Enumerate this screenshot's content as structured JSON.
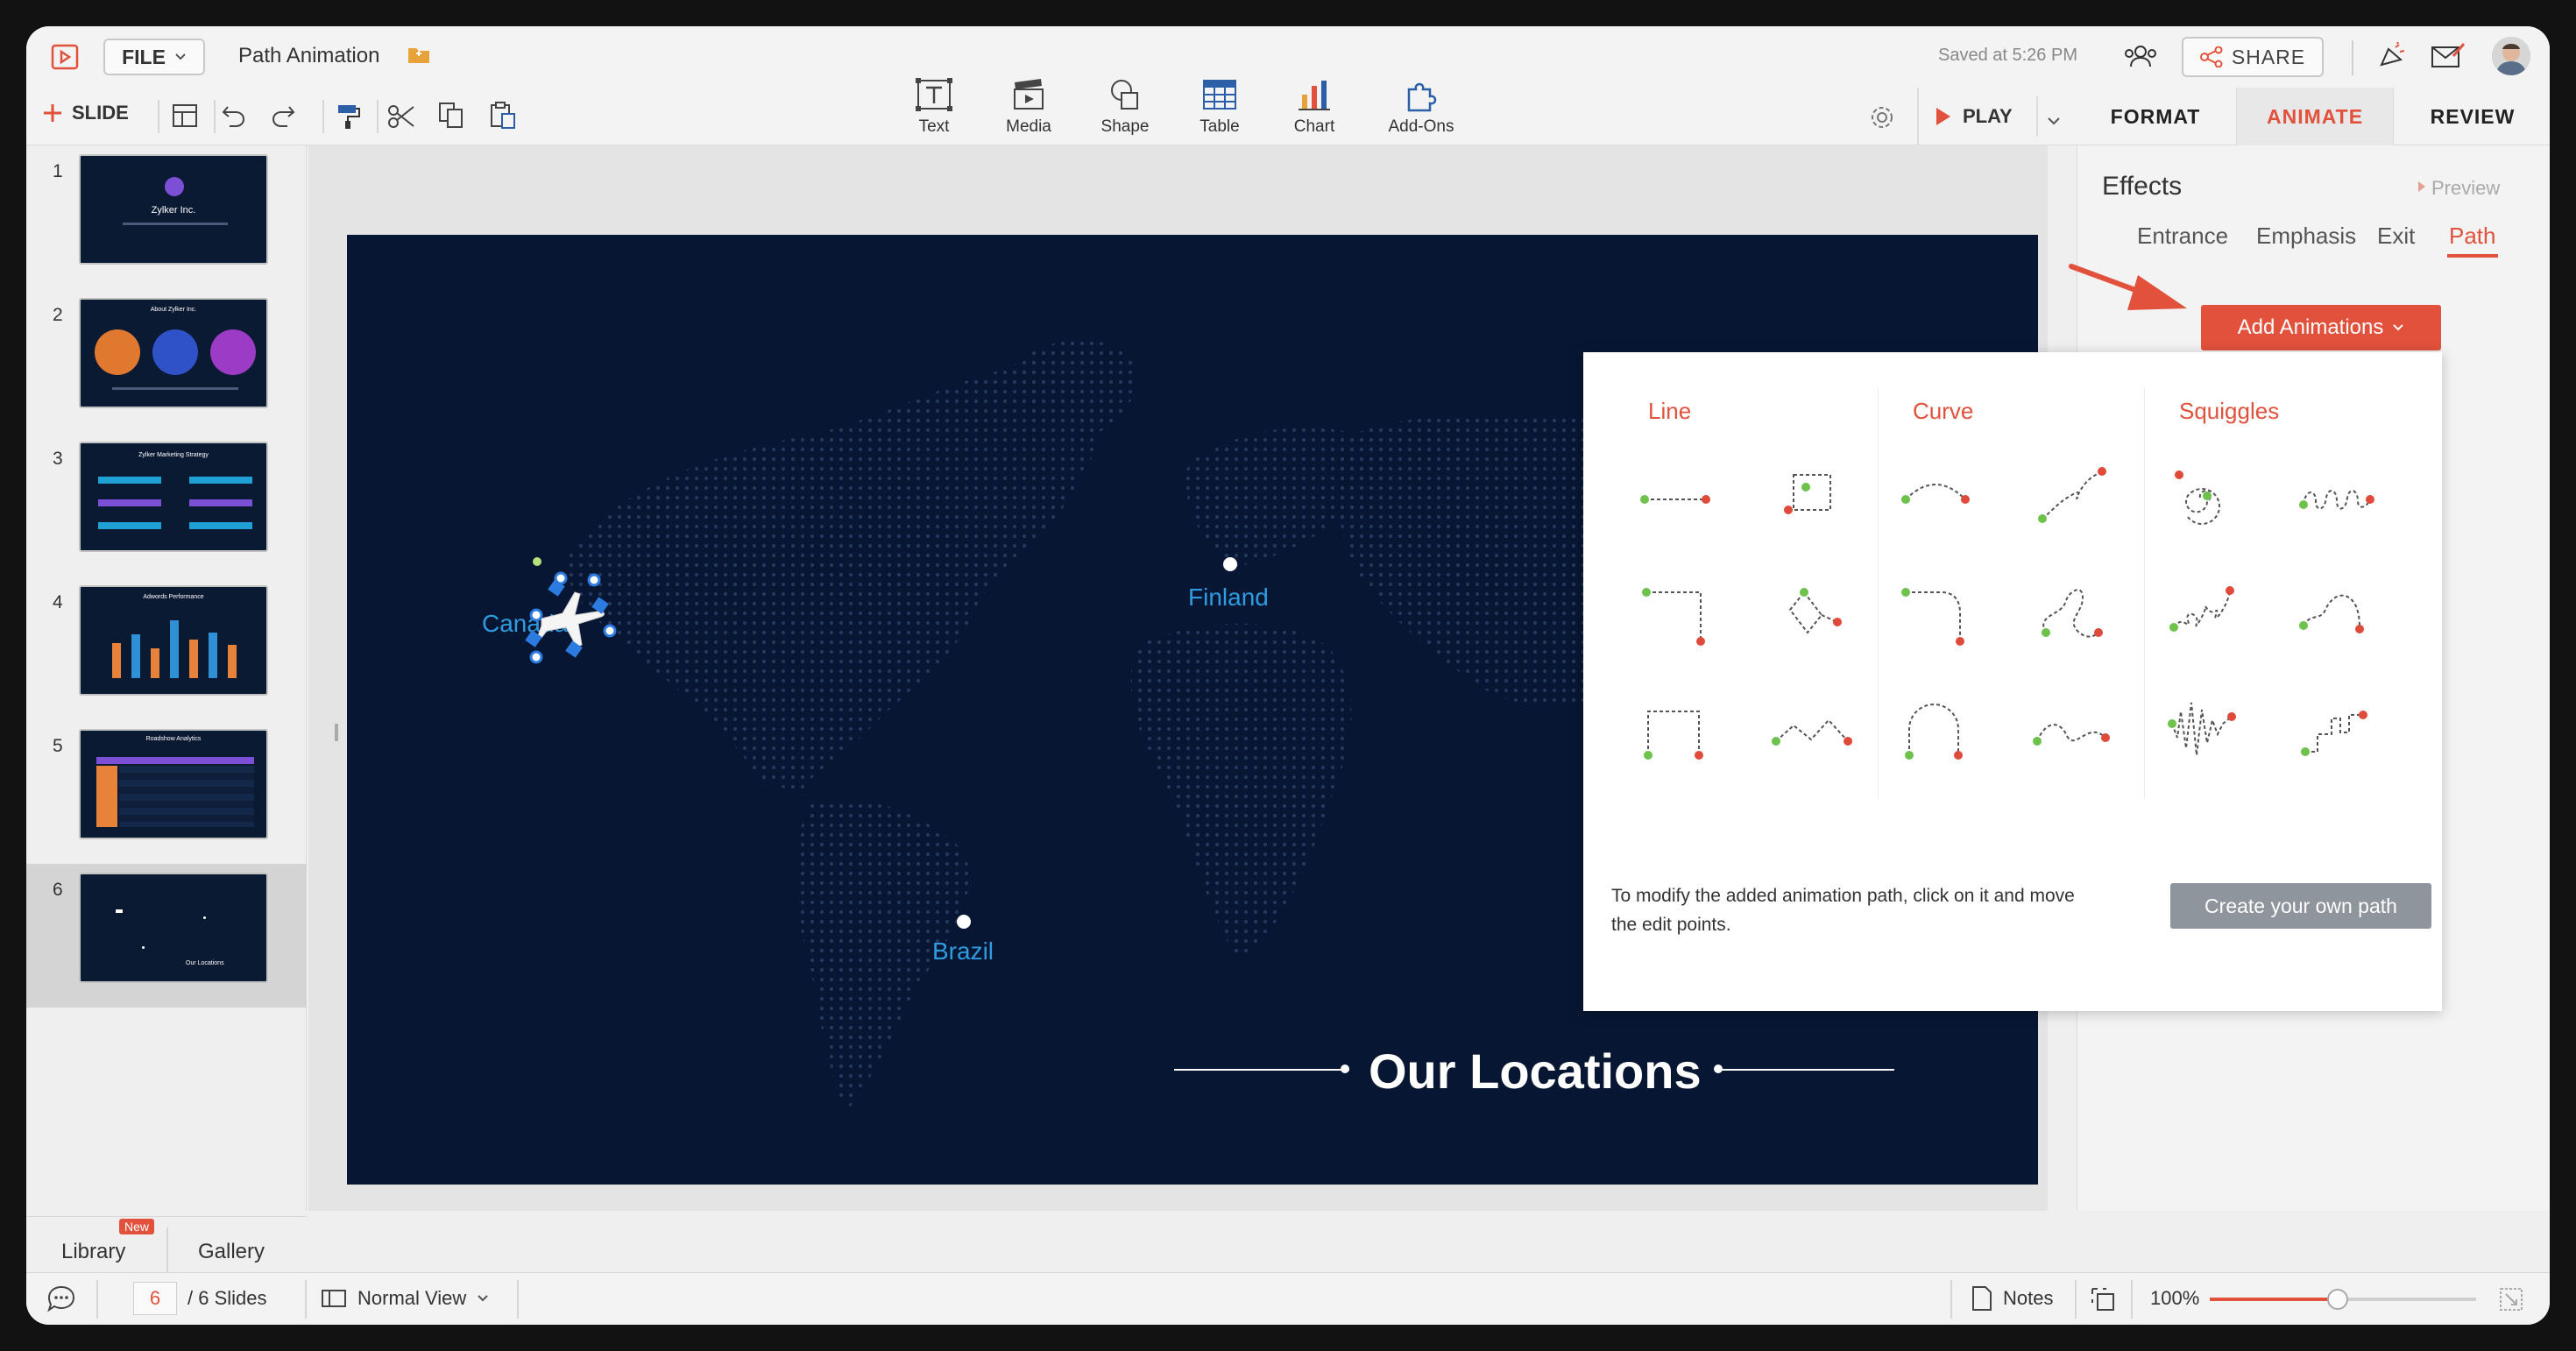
{
  "header": {
    "file_label": "FILE",
    "doc_title": "Path Animation",
    "saved_text": "Saved at 5:26 PM",
    "share_label": "SHARE"
  },
  "toolbar": {
    "slide_label": "SLIDE",
    "play_label": "PLAY",
    "insert": [
      {
        "label": "Text",
        "icon": "text-box-icon"
      },
      {
        "label": "Media",
        "icon": "media-icon"
      },
      {
        "label": "Shape",
        "icon": "shape-icon"
      },
      {
        "label": "Table",
        "icon": "table-icon"
      },
      {
        "label": "Chart",
        "icon": "bar-chart-icon"
      },
      {
        "label": "Add-Ons",
        "icon": "puzzle-icon"
      }
    ]
  },
  "right_tabs": [
    "FORMAT",
    "ANIMATE",
    "REVIEW"
  ],
  "effects": {
    "title": "Effects",
    "preview": "Preview",
    "tabs": [
      "Entrance",
      "Emphasis",
      "Exit",
      "Path"
    ],
    "active_tab": "Path",
    "add_button": "Add Animations"
  },
  "path_menu": {
    "categories": [
      "Line",
      "Curve",
      "Squiggles"
    ],
    "note": "To modify the added animation path, click on it and move the edit points.",
    "create_button": "Create your own path"
  },
  "slides": [
    {
      "num": "1",
      "title": "Zylker Inc."
    },
    {
      "num": "2",
      "title": "About Zylker Inc."
    },
    {
      "num": "3",
      "title": "Zylker Marketing Strategy"
    },
    {
      "num": "4",
      "title": "Adwords Performance"
    },
    {
      "num": "5",
      "title": "Roadshow Analytics"
    },
    {
      "num": "6",
      "title": "Our Locations"
    }
  ],
  "current_slide": {
    "heading": "Our Locations",
    "locations": [
      "Canada",
      "Finland",
      "Brazil"
    ]
  },
  "left_bottom": {
    "library": "Library",
    "badge": "New",
    "gallery": "Gallery"
  },
  "status": {
    "page_value": "6",
    "slides_total": "/ 6 Slides",
    "view_mode": "Normal View",
    "notes": "Notes",
    "zoom": "100%",
    "zoom_fraction": 0.48
  },
  "colors": {
    "accent": "#e2513b",
    "slide_bg": "#071633",
    "location_text": "#2f9be0"
  }
}
